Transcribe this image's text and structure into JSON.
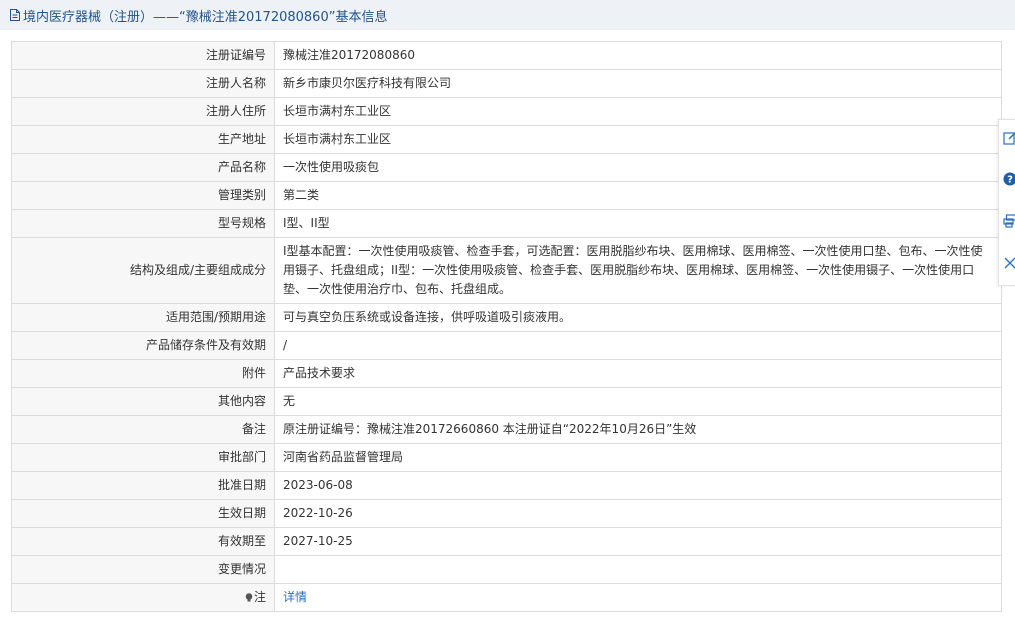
{
  "page": {
    "title": "境内医疗器械（注册）——“豫械注准20172080860”基本信息",
    "title_color": "#22558c",
    "link_color": "#2a6ec0"
  },
  "rows": [
    {
      "label": "注册证编号",
      "value": "豫械注准20172080860"
    },
    {
      "label": "注册人名称",
      "value": "新乡市康贝尔医疗科技有限公司"
    },
    {
      "label": "注册人住所",
      "value": "长垣市满村东工业区"
    },
    {
      "label": "生产地址",
      "value": "长垣市满村东工业区"
    },
    {
      "label": "产品名称",
      "value": "一次性使用吸痰包"
    },
    {
      "label": "管理类别",
      "value": "第二类"
    },
    {
      "label": "型号规格",
      "value": "I型、II型"
    },
    {
      "label": "结构及组成/主要组成成分",
      "value": "I型基本配置：一次性使用吸痰管、检查手套，可选配置：医用脱脂纱布块、医用棉球、医用棉签、一次性使用口垫、包布、一次性使用镊子、托盘组成；II型：一次性使用吸痰管、检查手套、医用脱脂纱布块、医用棉球、医用棉签、一次性使用镊子、一次性使用口垫、一次性使用治疗巾、包布、托盘组成。"
    },
    {
      "label": "适用范围/预期用途",
      "value": "可与真空负压系统或设备连接，供呼吸道吸引痰液用。"
    },
    {
      "label": "产品储存条件及有效期",
      "value": "/"
    },
    {
      "label": "附件",
      "value": "产品技术要求"
    },
    {
      "label": "其他内容",
      "value": "无"
    },
    {
      "label": "备注",
      "value": "原注册证编号：豫械注准20172660860 本注册证自“2022年10月26日”生效"
    },
    {
      "label": "审批部门",
      "value": "河南省药品监督管理局"
    },
    {
      "label": "批准日期",
      "value": "2023-06-08"
    },
    {
      "label": "生效日期",
      "value": "2022-10-26"
    },
    {
      "label": "有效期至",
      "value": "2027-10-25"
    },
    {
      "label": "变更情况",
      "value": ""
    }
  ],
  "note_row": {
    "label": "注",
    "link_text": "详情",
    "icon": "bulb-icon"
  },
  "side_toolbar": {
    "icons": [
      "edit-icon",
      "help-icon",
      "print-icon",
      "close-icon"
    ]
  }
}
